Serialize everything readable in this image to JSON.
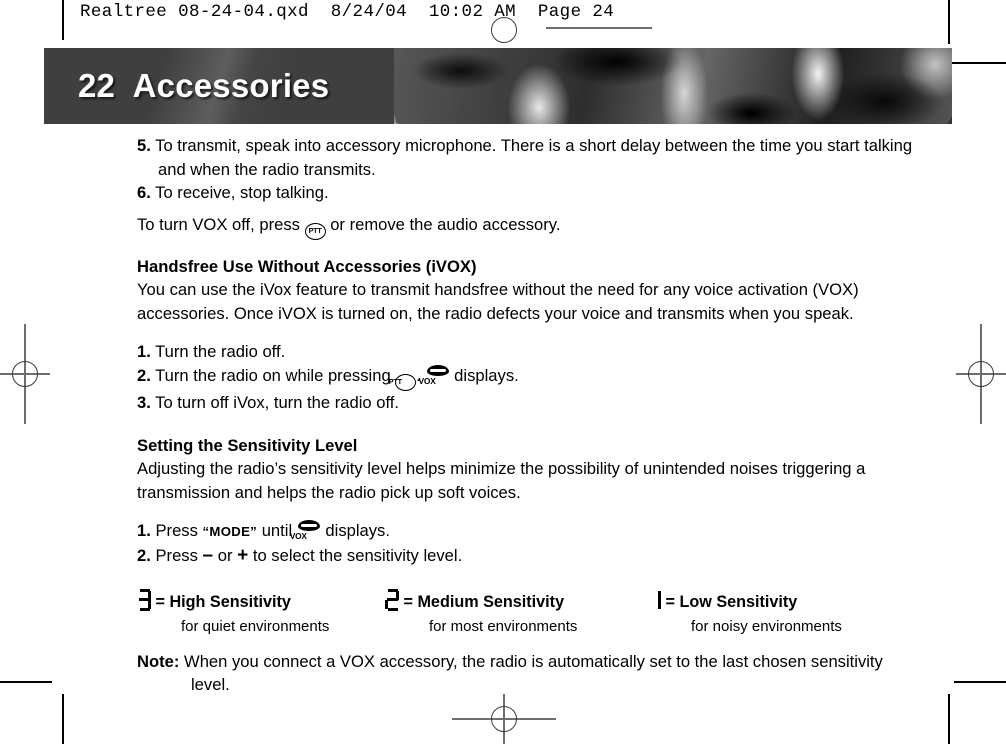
{
  "proof_header": {
    "text": "Realtree 08-24-04.qxd  8/24/04  10:02 AM  Page 24"
  },
  "banner": {
    "page_number": "22",
    "title": "Accessories",
    "full_title": "22  Accessories"
  },
  "body": {
    "step5": {
      "number": "5.",
      "text": "To transmit, speak into accessory microphone. There is a short delay between the time you start talking and when the radio transmits."
    },
    "step6": {
      "number": "6.",
      "text": "To receive, stop talking."
    },
    "vox_off": {
      "before": "To turn VOX off, press",
      "icon": "ptt-icon",
      "after": "or remove the audio accessory."
    },
    "handsfree": {
      "heading": "Handsfree Use Without Accessories (iVOX)",
      "paragraph": "You can use the iVox feature to transmit handsfree without the need for any voice activation (VOX) accessories. Once iVOX is turned on, the radio defects your voice and transmits when you speak."
    },
    "ivox_steps": {
      "step1": {
        "number": "1.",
        "text": "Turn the radio off."
      },
      "step2": {
        "number": "2.",
        "before": "Turn the radio on while pressing",
        "middle": ".",
        "after": "displays."
      },
      "step3": {
        "number": "3.",
        "text": "To turn off iVox, turn the radio off."
      }
    },
    "sensitivity": {
      "heading": "Setting the Sensitivity Level",
      "paragraph": "Adjusting the radio’s sensitivity level helps minimize the possibility of unintended noises triggering a transmission and helps the radio pick up soft voices.",
      "step1": {
        "number": "1.",
        "before": "Press",
        "key": "“MODE”",
        "middle": "until",
        "after": "displays."
      },
      "step2": {
        "number": "2.",
        "before": "Press",
        "minus": "–",
        "or": "or",
        "plus": "+",
        "after": "to select the sensitivity level."
      }
    },
    "levels": [
      {
        "digit": "3",
        "label": "= High Sensitivity",
        "detail": "for quiet environments"
      },
      {
        "digit": "2",
        "label": "= Medium Sensitivity",
        "detail": "for most environments"
      },
      {
        "digit": "1",
        "label": "= Low Sensitivity",
        "detail": "for noisy environments"
      }
    ],
    "note": {
      "label": "Note:",
      "text": "When you connect a VOX accessory, the radio is automatically set to the last chosen sensitivity level."
    }
  },
  "icons": {
    "ptt_label": "PTT",
    "vox_label": "VOX"
  }
}
